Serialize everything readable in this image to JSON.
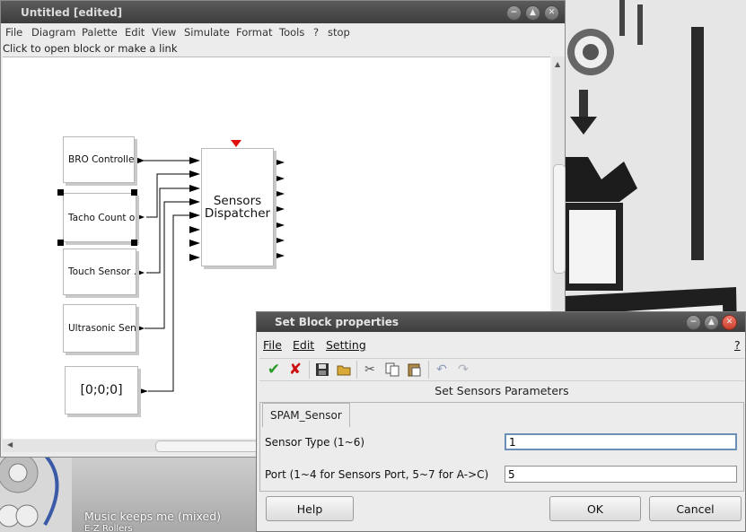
{
  "main_window": {
    "title": "Untitled [edited]",
    "menu": [
      "File",
      "Diagram",
      "Palette",
      "Edit",
      "View",
      "Simulate",
      "Format",
      "Tools",
      "?",
      "stop"
    ],
    "status": "Click to open block or make a link"
  },
  "blocks": {
    "bro": "BRO Controller",
    "tacho": "Tacho Count o..",
    "touch": "Touch Sensor ..",
    "ultrasonic": "Ultrasonic Sen..",
    "const": "[0;0;0]",
    "dispatcher_line1": "Sensors",
    "dispatcher_line2": "Dispatcher"
  },
  "dialog": {
    "title": "Set Block properties",
    "menu": {
      "file": "File",
      "edit": "Edit",
      "setting": "Setting",
      "help": "?"
    },
    "heading": "Set Sensors Parameters",
    "tab": "SPAM_Sensor",
    "fields": [
      {
        "label": "Sensor Type (1~6)",
        "value": "1"
      },
      {
        "label": "Port (1~4 for Sensors Port, 5~7 for A->C)",
        "value": "5"
      }
    ],
    "buttons": {
      "help": "Help",
      "ok": "OK",
      "cancel": "Cancel"
    }
  },
  "taskbar": {
    "song": "Music keeps me (mixed)",
    "artist": "E-Z Rollers"
  },
  "colors": {
    "accept": "#2a9a2a",
    "reject": "#cc1111",
    "port_marker": "#e01010"
  }
}
